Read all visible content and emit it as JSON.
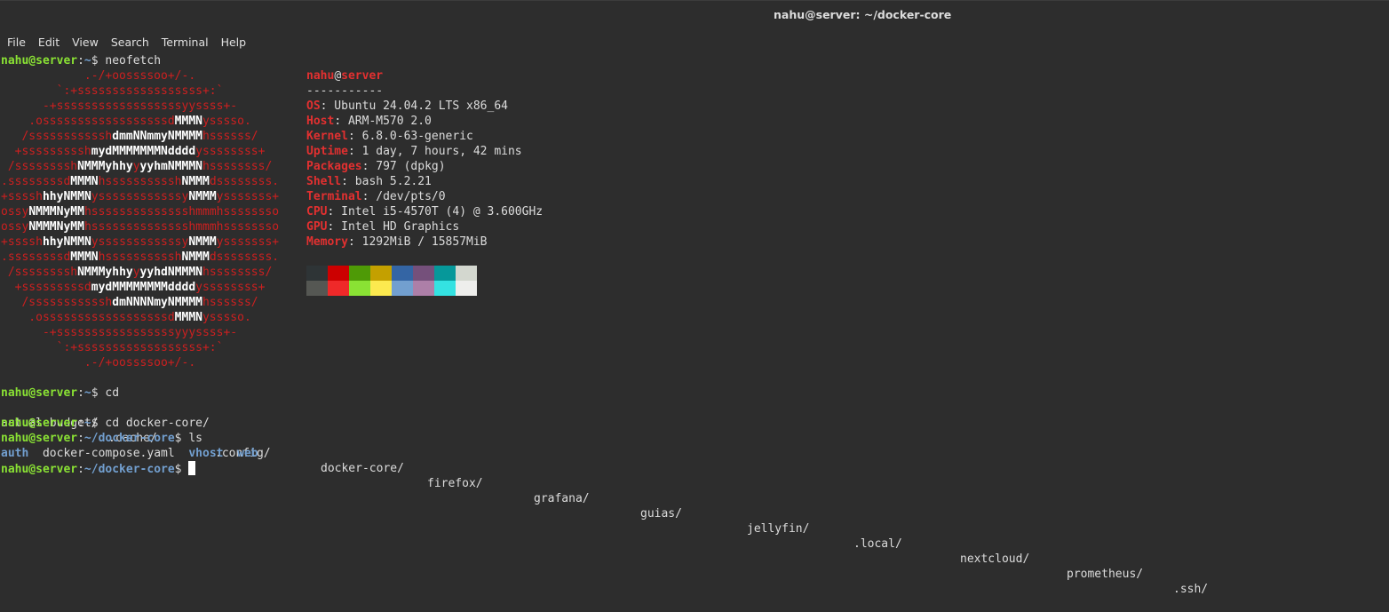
{
  "window": {
    "title": "nahu@server: ~/docker-core"
  },
  "menu": [
    "File",
    "Edit",
    "View",
    "Search",
    "Terminal",
    "Help"
  ],
  "prompt": {
    "user_host": "nahu@server",
    "home": "~",
    "dir_docker": "~/docker-core",
    "symbol": "$"
  },
  "commands": {
    "neofetch": " neofetch",
    "cd": " cd",
    "cd_docker": " cd docker-core/",
    "ls": " ls"
  },
  "ascii_art": [
    "            .-/+oossssoo+/-.",
    "        `:+ssssssssssssssssss+:`",
    "      -+ssssssssssssssssssyyssss+-",
    "    .ossssssssssssssssssdMMMNysssso.",
    "   /ssssssssssshdmmNNmmyNMMMMhssssss/",
    "  +ssssssssshmydMMMMMMMNddddyssssssss+",
    " /sssssssshNMMMyhhyyyyhmNMMMNhssssssss/",
    ".ssssssssdMMMNhsssssssssshNMMMdssssssss.",
    "+sssshhhyNMMNyssssssssssssyNMMMysssssss+",
    "ossyNMMMNyMMhsssssssssssssshmmmhssssssso",
    "ossyNMMMNyMMhsssssssssssssshmmmhssssssso",
    "+sssshhhyNMMNyssssssssssssyNMMMysssssss+",
    ".ssssssssdMMMNhsssssssssshNMMMdssssssss.",
    " /sssssssshNMMMyhhyyyyhdNMMMNhssssssss/",
    "  +sssssssssdmydMMMMMMMMddddyssssssss+",
    "   /ssssssssssshdmNNNNmyNMMMMhssssss/",
    "    .ossssssssssssssssssdMMMNysssso.",
    "      -+sssssssssssssssssyyyssss+-",
    "        `:+ssssssssssssssssss+:`",
    "            .-/+oossssoo+/-."
  ],
  "sysinfo": {
    "user": "nahu",
    "at": "@",
    "host": "server",
    "separator": "-----------",
    "fields": [
      {
        "key": "OS",
        "value": ": Ubuntu 24.04.2 LTS x86_64"
      },
      {
        "key": "Host",
        "value": ": ARM-M570 2.0"
      },
      {
        "key": "Kernel",
        "value": ": 6.8.0-63-generic"
      },
      {
        "key": "Uptime",
        "value": ": 1 day, 7 hours, 42 mins"
      },
      {
        "key": "Packages",
        "value": ": 797 (dpkg)"
      },
      {
        "key": "Shell",
        "value": ": bash 5.2.21"
      },
      {
        "key": "Terminal",
        "value": ": /dev/pts/0"
      },
      {
        "key": "CPU",
        "value": ": Intel i5-4570T (4) @ 3.600GHz"
      },
      {
        "key": "GPU",
        "value": ": Intel HD Graphics"
      },
      {
        "key": "Memory",
        "value": ": 1292MiB / 15857MiB"
      }
    ]
  },
  "palette": {
    "normal": [
      "#2e3436",
      "#cc0000",
      "#4e9a06",
      "#c4a000",
      "#3465a4",
      "#75507b",
      "#06989a",
      "#d3d7cf"
    ],
    "bright": [
      "#555753",
      "#ef2929",
      "#8ae234",
      "#fce94f",
      "#729fcf",
      "#ad7fa8",
      "#34e2e2",
      "#eeeeec"
    ]
  },
  "home_listing": [
    "actual-budget/",
    ".cache/",
    ".config/",
    "docker-core/",
    "firefox/",
    "grafana/",
    "guias/",
    "jellyfin/",
    ".local/",
    "nextcloud/",
    "prometheus/",
    ".ssh/"
  ],
  "docker_listing": {
    "auth": "auth",
    "compose": "docker-compose.yaml",
    "vhost": "vhost",
    "web": "web"
  }
}
